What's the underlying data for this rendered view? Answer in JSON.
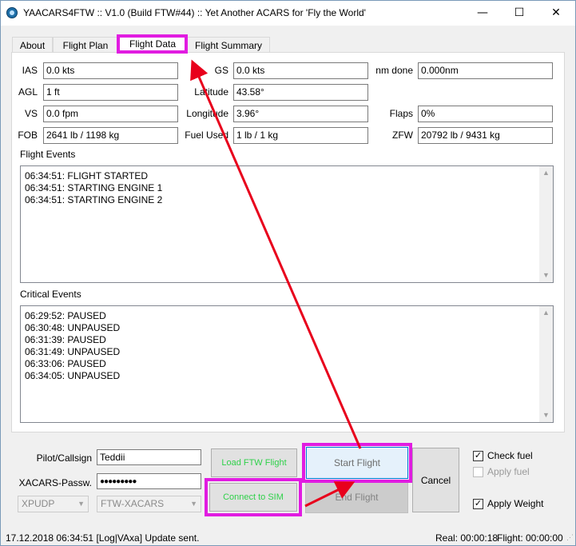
{
  "window": {
    "title": "YAACARS4FTW :: V1.0 (Build FTW#44) :: Yet Another ACARS for 'Fly the World'",
    "minimize_glyph": "—",
    "maximize_glyph": "☐",
    "close_glyph": "✕"
  },
  "tabs": [
    {
      "label": "About"
    },
    {
      "label": "Flight Plan"
    },
    {
      "label": "Flight Data"
    },
    {
      "label": "Flight Summary"
    }
  ],
  "active_tab": "Flight Data",
  "fields": {
    "ias": {
      "label": "IAS",
      "value": "0.0 kts"
    },
    "gs": {
      "label": "GS",
      "value": "0.0 kts"
    },
    "nm_done": {
      "label": "nm done",
      "value": "0.000nm"
    },
    "agl": {
      "label": "AGL",
      "value": "1 ft"
    },
    "latitude": {
      "label": "Latitude",
      "value": "43.58°"
    },
    "vs": {
      "label": "VS",
      "value": "0.0 fpm"
    },
    "longitude": {
      "label": "Longitude",
      "value": "3.96°"
    },
    "flaps": {
      "label": "Flaps",
      "value": "0%"
    },
    "fob": {
      "label": "FOB",
      "value": "2641 lb / 1198 kg"
    },
    "fuel_used": {
      "label": "Fuel Used",
      "value": "1 lb / 1 kg"
    },
    "zfw": {
      "label": "ZFW",
      "value": "20792 lb / 9431 kg"
    }
  },
  "flight_events": {
    "label": "Flight Events",
    "lines": [
      "06:34:51: FLIGHT STARTED",
      "06:34:51: STARTING ENGINE 1",
      "06:34:51: STARTING ENGINE 2"
    ]
  },
  "critical_events": {
    "label": "Critical Events",
    "lines": [
      "06:29:52: PAUSED",
      "06:30:48: UNPAUSED",
      "06:31:39: PAUSED",
      "06:31:49: UNPAUSED",
      "06:33:06: PAUSED",
      "06:34:05: UNPAUSED"
    ]
  },
  "login": {
    "callsign_label": "Pilot/Callsign",
    "callsign_value": "Teddii",
    "password_label": "XACARS-Passw.",
    "password_value": "●●●●●●●●●",
    "protocol_value": "XPUDP",
    "server_value": "FTW-XACARS"
  },
  "buttons": {
    "load_ftw_flight": "Load FTW Flight",
    "connect_to_sim": "Connect to SIM",
    "start_flight": "Start Flight",
    "end_flight": "End Flight",
    "cancel": "Cancel"
  },
  "options": {
    "check_fuel": {
      "label": "Check fuel",
      "checked": true
    },
    "apply_fuel": {
      "label": "Apply fuel",
      "checked": false,
      "disabled": true
    },
    "apply_weight": {
      "label": "Apply Weight",
      "checked": true
    }
  },
  "status": {
    "log": "17.12.2018 06:34:51 [Log|VAxa] Update sent.",
    "real": "Real: 00:00:18",
    "flight": "Flight: 00:00:00"
  },
  "colors": {
    "highlight": "#e11ce1",
    "arrow": "#e8001c",
    "green_text": "#2fd14a",
    "start_flight_bg": "#e5f1fb"
  }
}
